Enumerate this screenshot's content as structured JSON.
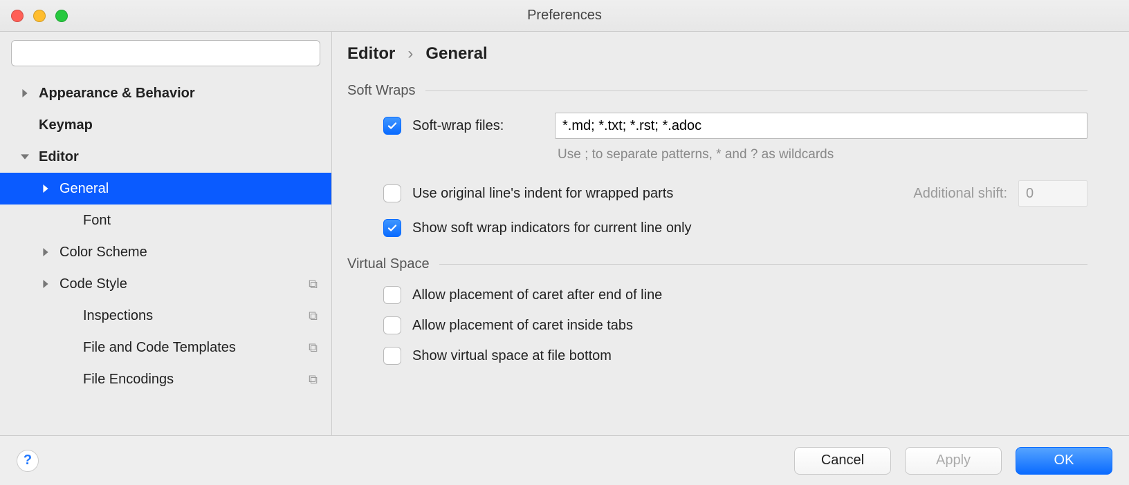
{
  "window": {
    "title": "Preferences"
  },
  "sidebar": {
    "search_placeholder": "",
    "items": [
      {
        "label": "Appearance & Behavior",
        "bold": true,
        "expand": "right",
        "indent": 0,
        "proj": false
      },
      {
        "label": "Keymap",
        "bold": true,
        "expand": "none",
        "indent": 0,
        "proj": false
      },
      {
        "label": "Editor",
        "bold": true,
        "expand": "down",
        "indent": 0,
        "proj": false
      },
      {
        "label": "General",
        "bold": false,
        "expand": "right",
        "indent": 1,
        "proj": false,
        "selected": true
      },
      {
        "label": "Font",
        "bold": false,
        "expand": "none",
        "indent": 2,
        "proj": false
      },
      {
        "label": "Color Scheme",
        "bold": false,
        "expand": "right",
        "indent": 1,
        "proj": false
      },
      {
        "label": "Code Style",
        "bold": false,
        "expand": "right",
        "indent": 1,
        "proj": true
      },
      {
        "label": "Inspections",
        "bold": false,
        "expand": "none",
        "indent": 2,
        "proj": true
      },
      {
        "label": "File and Code Templates",
        "bold": false,
        "expand": "none",
        "indent": 2,
        "proj": true
      },
      {
        "label": "File Encodings",
        "bold": false,
        "expand": "none",
        "indent": 2,
        "proj": true
      }
    ]
  },
  "breadcrumb": {
    "a": "Editor",
    "b": "General"
  },
  "softwraps": {
    "heading": "Soft Wraps",
    "enable_label": "Soft-wrap files:",
    "enable_checked": true,
    "patterns": "*.md; *.txt; *.rst; *.adoc",
    "hint": "Use ; to separate patterns, * and ? as wildcards",
    "orig_indent_label": "Use original line's indent for wrapped parts",
    "orig_indent_checked": false,
    "additional_shift_label": "Additional shift:",
    "additional_shift_value": "0",
    "indicators_label": "Show soft wrap indicators for current line only",
    "indicators_checked": true
  },
  "virtualspace": {
    "heading": "Virtual Space",
    "caret_eol_label": "Allow placement of caret after end of line",
    "caret_eol_checked": false,
    "caret_tabs_label": "Allow placement of caret inside tabs",
    "caret_tabs_checked": false,
    "bottom_label": "Show virtual space at file bottom",
    "bottom_checked": false
  },
  "footer": {
    "cancel": "Cancel",
    "apply": "Apply",
    "ok": "OK",
    "help": "?"
  }
}
